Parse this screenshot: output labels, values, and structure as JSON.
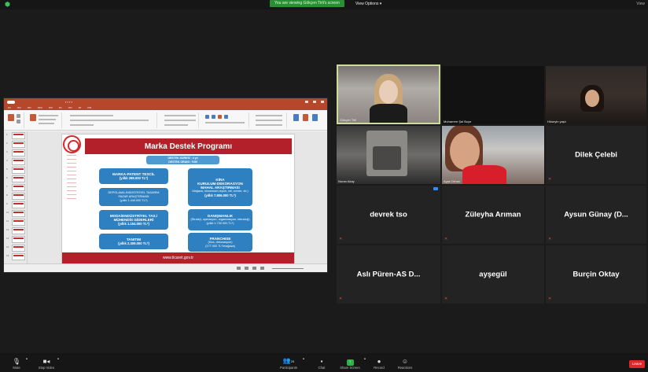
{
  "top_bar": {
    "viewing_text": "You are viewing Gökçen Tirli's screen",
    "view_options": "View Options ▾",
    "view_mode": "View"
  },
  "presentation": {
    "slide_title": "Marka Destek Programı",
    "duration": {
      "line1": "DESTEK SÜRESİ : 4 yıl",
      "line2": "DESTEK ORANI : %50"
    },
    "left_boxes": [
      {
        "title": "MARKA-PATENT TESCİL",
        "amount": "(yıllık 288.000 TL*)"
      },
      {
        "title": "DEPOLAMA-İNDÜSTRİYEL TASARIM",
        "subtitle": "PAZAR ARAŞTIRMASI",
        "amount": "(yıllık 1.440.000 TL*)"
      },
      {
        "title": "MODA/ENDÜSTRİYEL TAS./",
        "subtitle": "MÜHENDİS GİDERLERİ",
        "amount": "(yıllık 1.154.000 TL*)"
      },
      {
        "title": "TANITIM",
        "amount": "(yıllık 2.309.000 TL*)"
      }
    ],
    "right_boxes": [
      {
        "title": "KİRA",
        "subtitle": "KURULUM-DEKORASYON",
        "subtitle2": "MAHAL ARAŞTIRMASI",
        "detail": "Mağaza, showroom,reyon, raf, corner, vb.)",
        "amount": "(yıllık 7.806.000 TL*)"
      },
      {
        "title": "DANIŞMANLIK",
        "detail": "(Strateji, operasyon, organizasyon, teknoloji)",
        "amount": "(yıllık 1.732.000 TL*)"
      },
      {
        "title": "FRANCHISE",
        "detail": "(Kira, dekorasyon)",
        "amount": "(177.000 TL*/mağaza)"
      }
    ],
    "footer": "www.ticaret.gov.tr"
  },
  "participants": [
    {
      "name": "Gökçen Tirli",
      "has_video": true
    },
    {
      "name": "Muharrem Şal Buye",
      "has_video": true
    },
    {
      "name": "Hüseyin yaşlı",
      "has_video": true
    },
    {
      "name": "Nuran Akay",
      "has_video": true
    },
    {
      "name": "Ayşe Orhan",
      "has_video": true
    },
    {
      "name": "Dilek Çelebi",
      "has_video": false
    },
    {
      "name": "devrek tso",
      "has_video": false
    },
    {
      "name": "Züleyha Arıman",
      "has_video": false
    },
    {
      "name": "Aysun Günay (D...",
      "has_video": false
    },
    {
      "name": "Aslı Püren-AS D...",
      "has_video": false
    },
    {
      "name": "ayşegül",
      "has_video": false
    },
    {
      "name": "Burçin Oktay",
      "has_video": false
    }
  ],
  "toolbar": {
    "mute": "Mute",
    "stop_video": "Stop Video",
    "participants": "Participants",
    "participants_count": "25",
    "chat": "Chat",
    "share_screen": "Share Screen",
    "record": "Record",
    "reactions": "Reactions",
    "leave": "Leave"
  },
  "colors": {
    "slide_red": "#b3202a",
    "box_blue": "#2f80c0",
    "share_green": "#2bb34a",
    "leave_red": "#e02828",
    "viewing_green": "#2a8f34"
  }
}
